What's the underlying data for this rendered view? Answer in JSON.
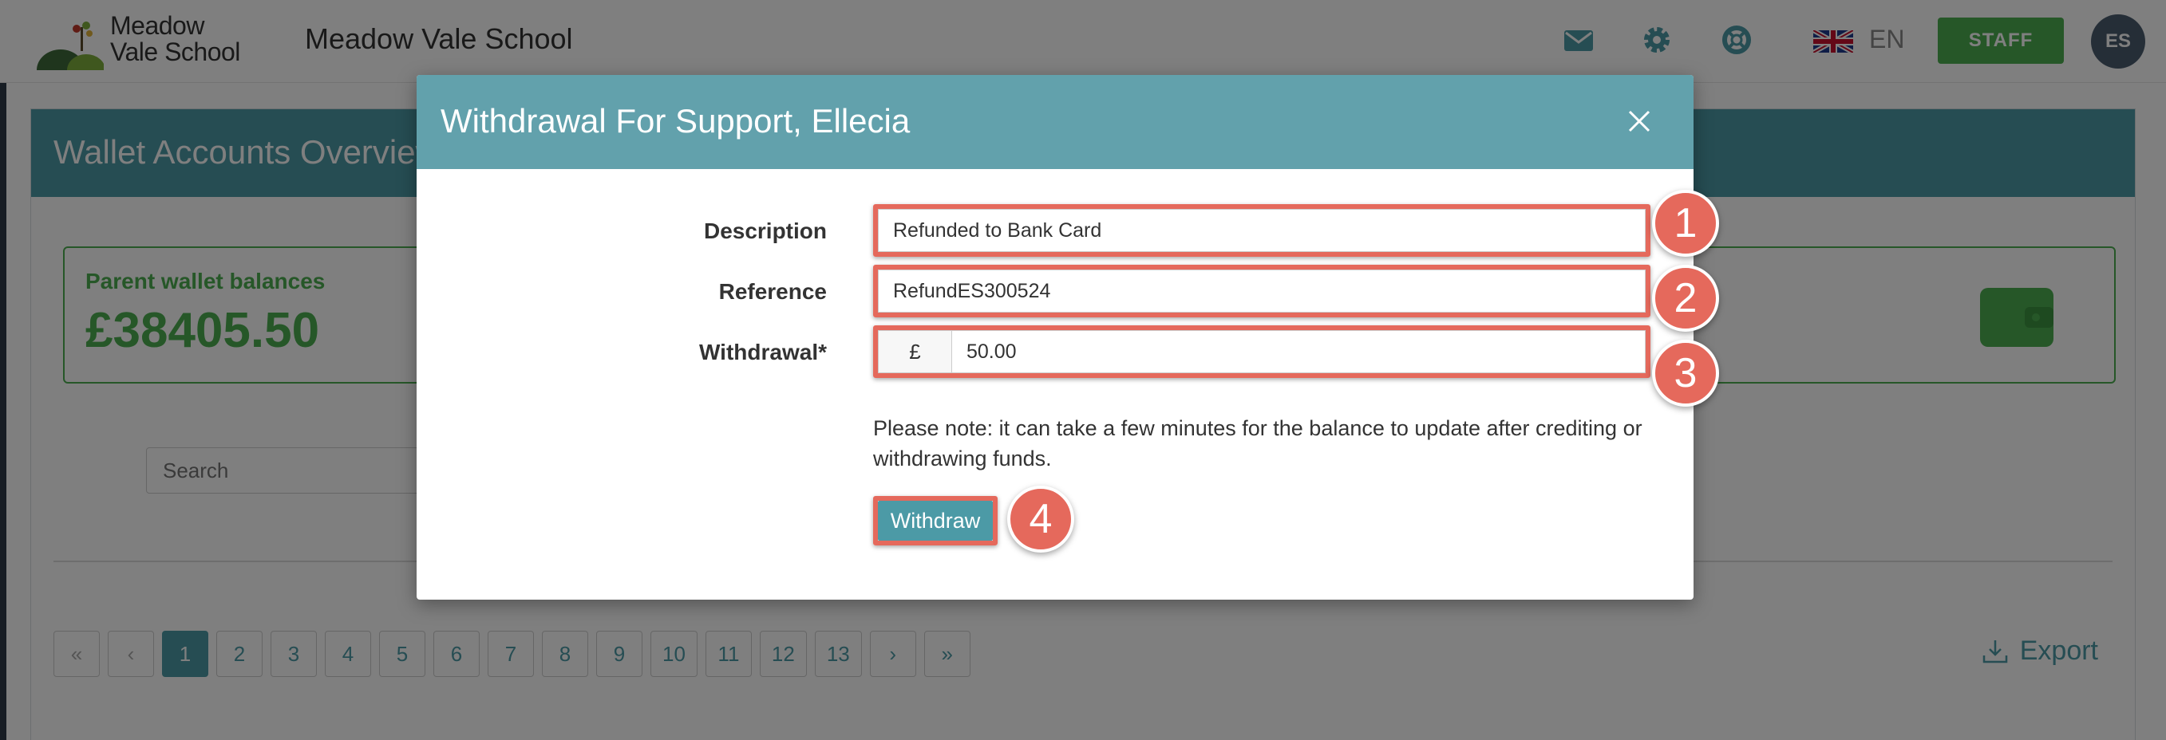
{
  "header": {
    "logo_line1": "Meadow",
    "logo_line2": "Vale School",
    "school_name": "Meadow Vale School",
    "language": "EN",
    "staff_label": "STAFF",
    "avatar_initials": "ES"
  },
  "page": {
    "title": "Wallet Accounts Overview",
    "balance_label": "Parent wallet balances",
    "balance_value": "£38405.50",
    "search_placeholder": "Search",
    "export_label": "Export",
    "pagination": [
      "«",
      "‹",
      "1",
      "2",
      "3",
      "4",
      "5",
      "6",
      "7",
      "8",
      "9",
      "10",
      "11",
      "12",
      "13",
      "›",
      "»"
    ],
    "active_page": "1"
  },
  "modal": {
    "title": "Withdrawal For Support, Ellecia",
    "description_label": "Description",
    "description_value": "Refunded to Bank Card",
    "reference_label": "Reference",
    "reference_value": "RefundES300524",
    "withdrawal_label": "Withdrawal*",
    "currency_symbol": "£",
    "withdrawal_value": "50.00",
    "note": "Please note: it can take a few minutes for the balance to update after crediting or withdrawing funds.",
    "withdraw_button": "Withdraw"
  },
  "annotations": [
    "1",
    "2",
    "3",
    "4"
  ],
  "colors": {
    "teal": "#4c9aa6",
    "modal_header": "#62a1ac",
    "green": "#4caf50",
    "highlight": "#e5695c"
  },
  "icons": [
    "mail-icon",
    "gear-icon",
    "lifebuoy-icon",
    "uk-flag-icon",
    "wallet-icon",
    "close-icon",
    "download-icon"
  ]
}
